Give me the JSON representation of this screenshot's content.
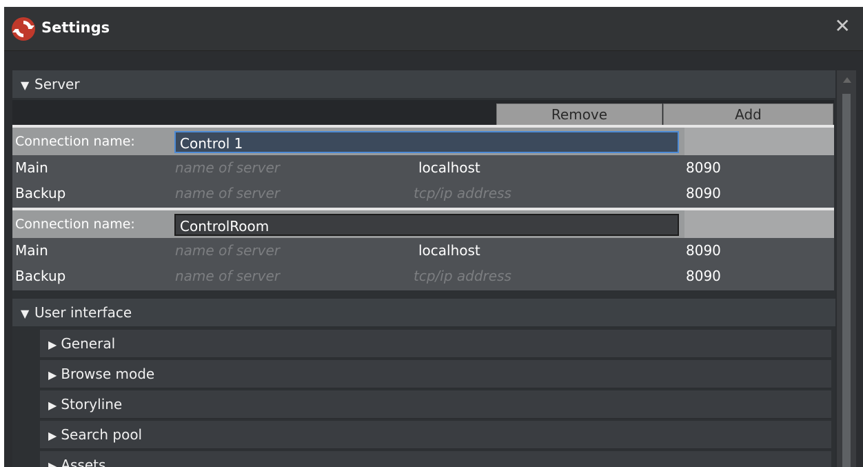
{
  "window": {
    "title": "Settings",
    "close_glyph": "✕",
    "logo_icon": "refresh-logo-icon",
    "accent_colors": {
      "logo_dark": "#c0392b",
      "logo_light": "#ffffff"
    }
  },
  "server": {
    "header": "Server",
    "expanded_glyph": "▼",
    "remove_label": "Remove",
    "add_label": "Add",
    "connections": [
      {
        "name_label": "Connection name:",
        "name_value": "Control 1",
        "rows": [
          {
            "label": "Main",
            "name_placeholder": "name of server",
            "address": "localhost",
            "address_is_placeholder": false,
            "port": "8090"
          },
          {
            "label": "Backup",
            "name_placeholder": "name of server",
            "address": "tcp/ip address",
            "address_is_placeholder": true,
            "port": "8090"
          }
        ]
      },
      {
        "name_label": "Connection name:",
        "name_value": "ControlRoom",
        "rows": [
          {
            "label": "Main",
            "name_placeholder": "name of server",
            "address": "localhost",
            "address_is_placeholder": false,
            "port": "8090"
          },
          {
            "label": "Backup",
            "name_placeholder": "name of server",
            "address": "tcp/ip address",
            "address_is_placeholder": true,
            "port": "8090"
          }
        ]
      }
    ]
  },
  "user_interface": {
    "header": "User interface",
    "expanded_glyph": "▼",
    "collapsed_glyph": "▶",
    "items": [
      "General",
      "Browse mode",
      "Storyline",
      "Search pool",
      "Assets"
    ]
  }
}
